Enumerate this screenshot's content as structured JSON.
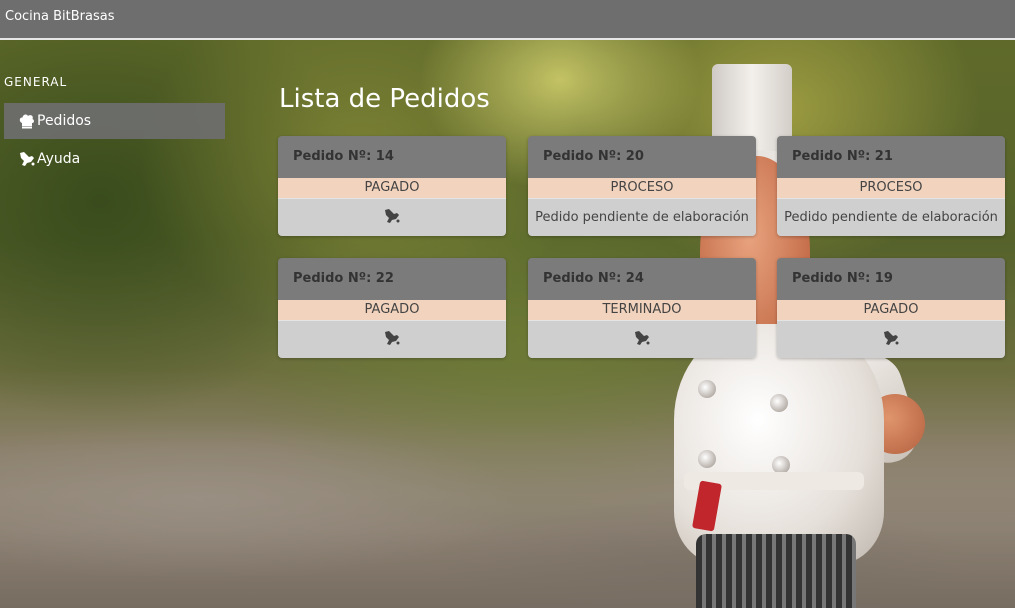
{
  "app": {
    "title": "Cocina BitBrasas"
  },
  "sidebar": {
    "section_title": "GENERAL",
    "items": [
      {
        "label": "Pedidos",
        "icon": "chef-hat-icon",
        "active": true
      },
      {
        "label": "Ayuda",
        "icon": "help-hand-icon",
        "active": false
      }
    ]
  },
  "main": {
    "title": "Lista de Pedidos",
    "orders": [
      {
        "header": "Pedido Nº: 14",
        "status": "PAGADO",
        "body_text": "",
        "body_icon": "hand-icon"
      },
      {
        "header": "Pedido Nº: 20",
        "status": "PROCESO",
        "body_text": "Pedido pendiente de elaboración",
        "body_icon": ""
      },
      {
        "header": "Pedido Nº: 21",
        "status": "PROCESO",
        "body_text": "Pedido pendiente de elaboración",
        "body_icon": ""
      },
      {
        "header": "Pedido Nº: 22",
        "status": "PAGADO",
        "body_text": "",
        "body_icon": "hand-icon"
      },
      {
        "header": "Pedido Nº: 24",
        "status": "TERMINADO",
        "body_text": "",
        "body_icon": "hand-icon"
      },
      {
        "header": "Pedido Nº: 19",
        "status": "PAGADO",
        "body_text": "",
        "body_icon": "hand-icon"
      }
    ]
  },
  "colors": {
    "topbar": "#6e6e6e",
    "card_header": "#7b7b7b",
    "card_status": "#f2d3bd",
    "card_body": "#cfcfcf"
  }
}
